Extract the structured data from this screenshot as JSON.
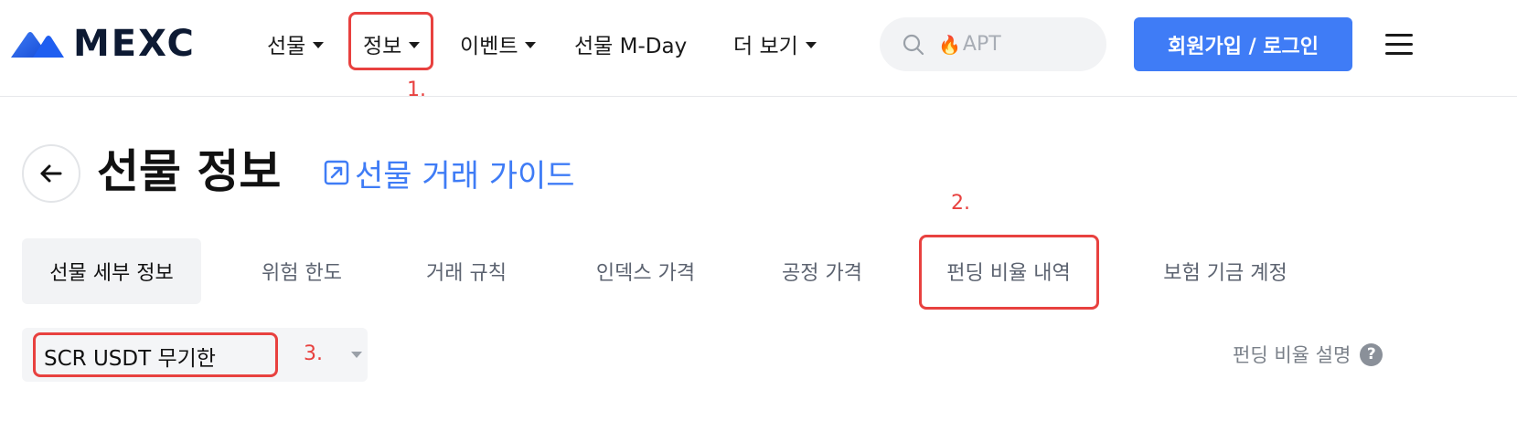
{
  "header": {
    "logo_text": "MEXC",
    "nav": {
      "futures": "선물",
      "info": "정보",
      "events": "이벤트",
      "mday": "선물 M-Day",
      "more": "더 보기"
    },
    "search": {
      "placeholder": "APT",
      "icon": "search-icon"
    },
    "signup_label": "회원가입 / 로그인",
    "menu_icon": "hamburger-menu-icon"
  },
  "page": {
    "title": "선물 정보",
    "guide_link": "선물 거래 가이드"
  },
  "tabs": [
    {
      "label": "선물 세부 정보",
      "active": true
    },
    {
      "label": "위험 한도",
      "active": false
    },
    {
      "label": "거래 규칙",
      "active": false
    },
    {
      "label": "인덱스 가격",
      "active": false
    },
    {
      "label": "공정 가격",
      "active": false
    },
    {
      "label": "펀딩 비율 내역",
      "active": false
    },
    {
      "label": "보험 기금 계정",
      "active": false
    }
  ],
  "selector": {
    "value": "SCR USDT 무기한"
  },
  "help_link": "펀딩 비율 설명",
  "annotations": {
    "n1": "1.",
    "n2": "2.",
    "n3": "3."
  },
  "colors": {
    "accent": "#3f7cf6",
    "annotation": "#e8413f",
    "logo_dark": "#0d1a33"
  }
}
